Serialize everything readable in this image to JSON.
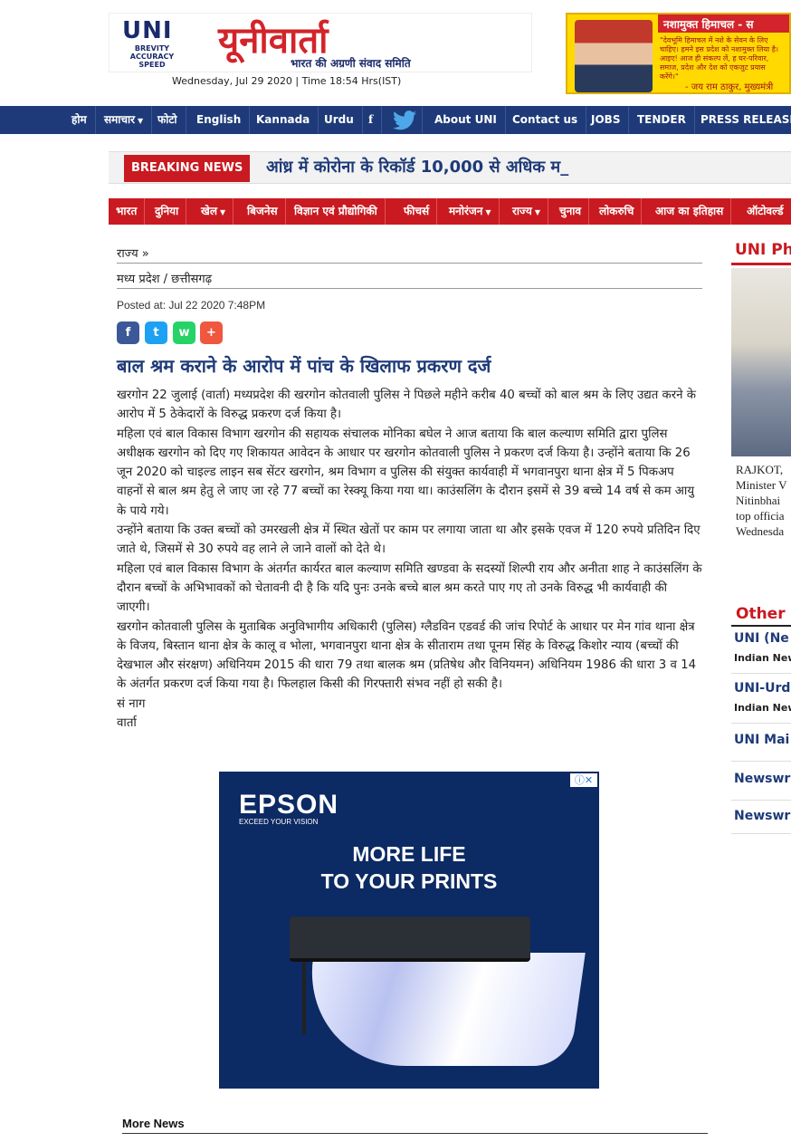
{
  "header": {
    "logo_abbr": "UNI",
    "logo_tagline": [
      "BREVITY",
      "ACCURACY",
      "SPEED"
    ],
    "logo_hindi": "यूनीवार्ता",
    "logo_sub": "भारत की अग्रणी संवाद समिति",
    "date_line": "Wednesday, Jul 29 2020 | Time 18:54 Hrs(IST)"
  },
  "top_ad": {
    "title": "नशामुक्त हिमाचल - स",
    "text": "\"देवभूमि हिमाचल में नशे के सेवन के लिए चाहिए। हमने इस प्रदेश को नशामुक्त लिया है। आइए! आज ही संकल्प लें, ह घर-परिवार, समाज, प्रदेश और देश को एकजुट प्रयास करेंगे।\"",
    "signature": "- जय राम ठाकुर, मुख्यमंत्री"
  },
  "nav": {
    "items": [
      "होम",
      "समाचार",
      "फोटो",
      "English",
      "Kannada",
      "Urdu",
      "About UNI",
      "Contact us",
      "JOBS",
      "TENDER",
      "PRESS RELEASE"
    ]
  },
  "breaking": {
    "label": "BREAKING NEWS",
    "text": "आंध्र में कोरोना के रिकॉर्ड 10,000 से अधिक म_"
  },
  "categories": [
    "भारत",
    "दुनिया",
    "खेल",
    "बिजनेस",
    "विज्ञान एवं प्रौद्योगिकी",
    "फीचर्स",
    "मनोरंजन",
    "राज्य",
    "चुनाव",
    "लोकरुचि",
    "आज का इतिहास",
    "ऑटोवर्ल्ड"
  ],
  "article": {
    "breadcrumb": "राज्य »",
    "section": "मध्य प्रदेश / छत्तीसगढ़",
    "posted": "Posted at: Jul 22 2020 7:48PM",
    "share_icons": [
      "f",
      "t",
      "w",
      "+"
    ],
    "headline": "बाल श्रम कराने के आरोप में पांच के खिलाफ प्रकरण दर्ज",
    "paragraphs": [
      "खरगोन 22 जुलाई (वार्ता) मध्यप्रदेश की खरगोन कोतवाली पुलिस ने पिछले महीने करीब 40 बच्चों को बाल श्रम के लिए उद्यत करने के आरोप में 5 ठेकेदारों के विरुद्ध प्रकरण दर्ज किया है।",
      "महिला एवं बाल विकास विभाग खरगोन की सहायक संचालक मोनिका बघेल ने आज बताया कि बाल कल्याण समिति द्वारा पुलिस अधीक्षक खरगोन को दिए गए शिकायत आवेदन के आधार पर खरगोन कोतवाली पुलिस ने प्रकरण दर्ज किया है। उन्होंने बताया कि 26 जून 2020 को चाइल्ड लाइन सब सेंटर खरगोन, श्रम विभाग व पुलिस की संयुक्त कार्यवाही में भगवानपुरा थाना क्षेत्र में 5 पिकअप वाहनों से बाल श्रम हेतु ले जाए जा रहे 77 बच्चों का रेस्क्यू किया गया था। काउंसलिंग के दौरान इसमें से 39 बच्चे 14 वर्ष से कम आयु के पाये गये।",
      "उन्होंने बताया कि उक्त बच्चों को उमरखली क्षेत्र में स्थित खेतों पर काम पर लगाया जाता था और इसके एवज में 120 रुपये प्रतिदिन दिए जाते थे, जिसमें से 30 रुपये वह लाने ले जाने वालों को देते थे।",
      "महिला एवं बाल विकास विभाग के अंतर्गत कार्यरत बाल कल्याण समिति खण्डवा के सदस्यों शिल्पी राय और अनीता शाह ने काउंसलिंग के दौरान बच्चों के अभिभावकों को चेतावनी दी है कि यदि पुनः उनके बच्चे बाल श्रम करते पाए गए तो उनके विरुद्ध भी कार्यवाही की जाएगी।",
      "खरगोन कोतवाली पुलिस के मुताबिक अनुविभागीय अधिकारी (पुलिस) ग्लैडविन एडवर्ड की जांच रिपोर्ट के आधार पर मेन गांव थाना क्षेत्र के विजय, बिस्तान थाना क्षेत्र के कालू व भोला, भगवानपुरा थाना क्षेत्र के सीताराम तथा पूनम सिंह के विरुद्ध किशोर न्याय (बच्चों की देखभाल और संरक्षण) अधिनियम 2015 की धारा 79 तथा बालक श्रम (प्रतिषेध और विनियमन) अधिनियम 1986 की धारा 3 व 14 के अंतर्गत प्रकरण दर्ज किया गया है। फिलहाल किसी की गिरफ्तारी संभव नहीं हो सकी है।",
      "सं नाग",
      "वार्ता"
    ]
  },
  "ad": {
    "brand": "EPSON",
    "tagline": "EXCEED YOUR VISION",
    "line1": "MORE LIFE",
    "line2": "TO YOUR PRINTS",
    "close_label": "ⓘ✕"
  },
  "sidebar": {
    "photo_title": "UNI Ph",
    "photo_caption": [
      "RAJKOT,",
      "Minister V",
      "Nitinbhai",
      "top officia",
      "Wednesda"
    ],
    "other_title": "Other",
    "other_items": [
      {
        "label": "UNI (Ne",
        "sub": "Indian New"
      },
      {
        "label": "UNI-Urd",
        "sub": "Indian New"
      },
      {
        "label": "UNI Mai",
        "sub": ""
      },
      {
        "label": "Newswr",
        "sub": ""
      },
      {
        "label": "Newswr",
        "sub": ""
      }
    ]
  },
  "footer": {
    "more_news": "More News"
  },
  "colors": {
    "navy": "#1e3a78",
    "red": "#c81a20"
  }
}
